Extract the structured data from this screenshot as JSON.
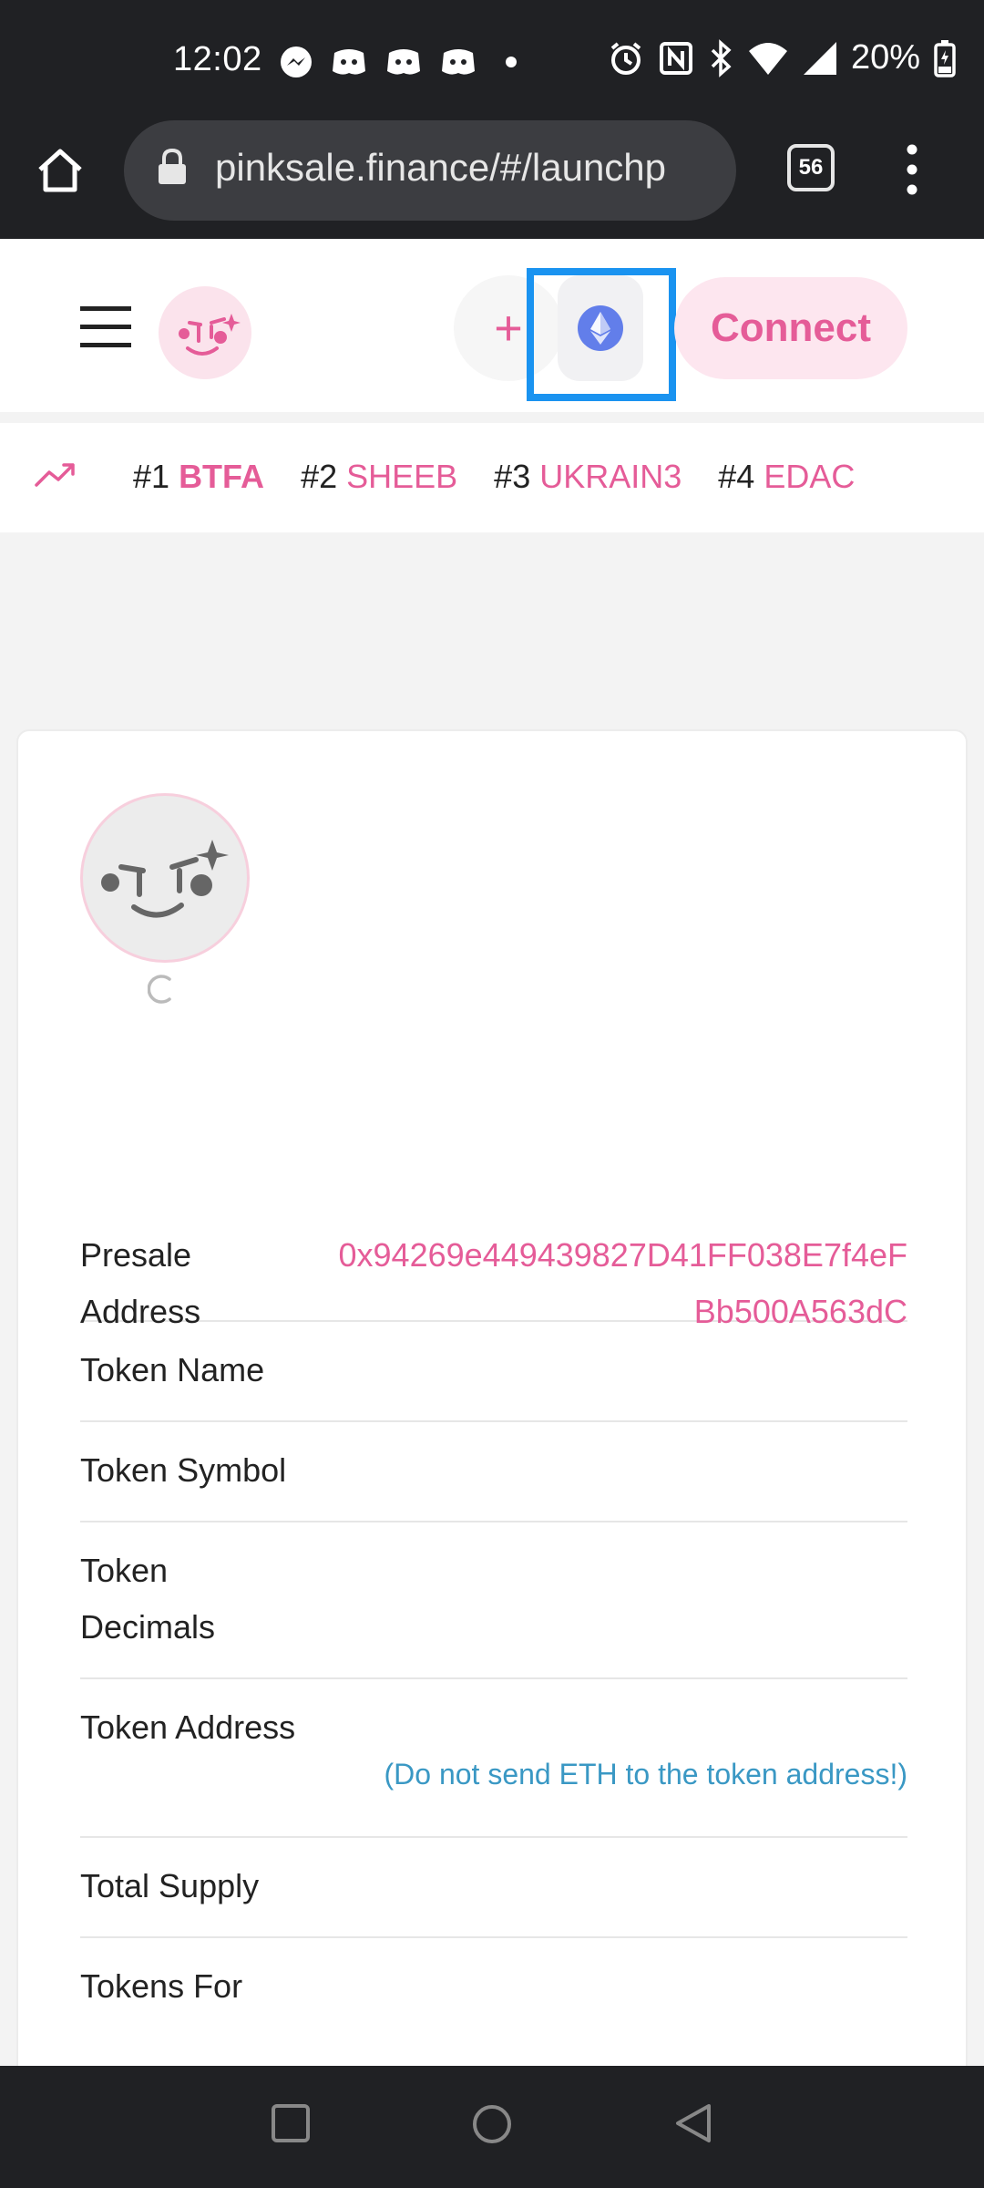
{
  "status_bar": {
    "time": "12:02",
    "battery": "20%",
    "icons_left": [
      "messenger-icon",
      "discord-icon",
      "discord-icon",
      "discord-icon",
      "dot-icon"
    ],
    "icons_right": [
      "alarm-icon",
      "nfc-icon",
      "bluetooth-icon",
      "wifi-icon",
      "signal-icon",
      "battery-icon"
    ]
  },
  "browser": {
    "url": "pinksale.finance/#/launchp",
    "tab_count": "56"
  },
  "header": {
    "plus_label": "+",
    "connect_label": "Connect",
    "colors": {
      "accent": "#e55c98",
      "highlight": "#1a93f0"
    }
  },
  "trending": {
    "items": [
      {
        "rank": "#1",
        "symbol": "BTFA"
      },
      {
        "rank": "#2",
        "symbol": "SHEEB"
      },
      {
        "rank": "#3",
        "symbol": "UKRAIN3"
      },
      {
        "rank": "#4",
        "symbol": "EDAC"
      }
    ]
  },
  "details": {
    "presale_address_label": "Presale Address",
    "presale_address_value": "0x94269e449439827D41FF038E7f4eFBb500A563dC",
    "token_name_label": "Token Name",
    "token_symbol_label": "Token Symbol",
    "token_decimals_label": "Token Decimals",
    "token_address_label": "Token Address",
    "token_address_note": "(Do not send ETH to the token address!)",
    "total_supply_label": "Total Supply",
    "tokens_for_label": "Tokens For"
  }
}
